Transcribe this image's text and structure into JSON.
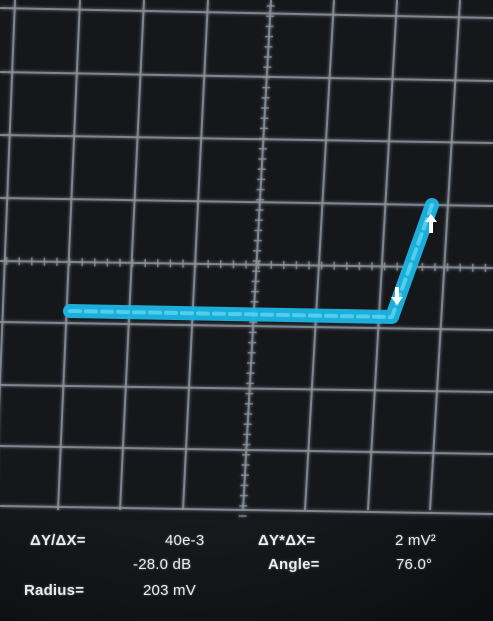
{
  "display": {
    "background_color": "#15171b",
    "grid_color": "#8b929c",
    "trace_color": "#1ab6e3",
    "arrow_color": "#ffffff",
    "trace_shape": "horizontal segment then steep rise",
    "markers": [
      {
        "name": "down-arrow-marker",
        "direction": "down"
      },
      {
        "name": "up-arrow-marker",
        "direction": "up"
      }
    ]
  },
  "measurements": {
    "dy_dx_label": "ΔY/ΔX=",
    "dy_dx_value": "40e-3",
    "db_value": "-28.0 dB",
    "dy_times_dx_label": "ΔY*ΔX=",
    "dy_times_dx_value": "2 mV²",
    "angle_label": "Angle=",
    "angle_value": "76.0°",
    "radius_label": "Radius=",
    "radius_value": "203 mV"
  }
}
